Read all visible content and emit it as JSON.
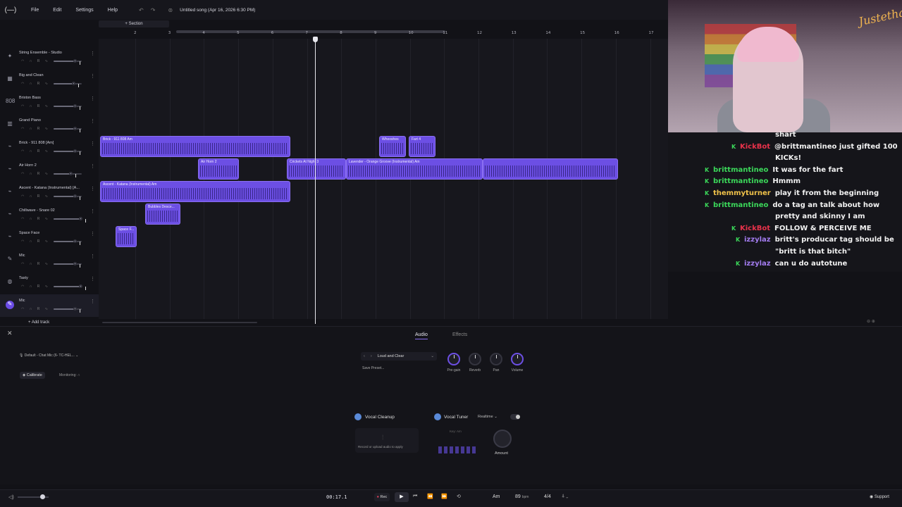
{
  "app": {
    "logo": "(—)",
    "menu": [
      "File",
      "Edit",
      "Settings",
      "Help"
    ],
    "song_title": "Untitled song (Apr 16, 2026 6:30 PM)"
  },
  "section": {
    "label": "+ Section"
  },
  "ruler": {
    "ticks": [
      "2",
      "3",
      "4",
      "5",
      "6",
      "7",
      "8",
      "9",
      "10",
      "11",
      "12",
      "13",
      "14",
      "15",
      "16",
      "17"
    ]
  },
  "tracks": [
    {
      "name": "String Ensemble - Studio",
      "icon": "strings-icon",
      "glyph": "✦",
      "volume": 0.75
    },
    {
      "name": "Big and Clean",
      "icon": "synth-icon",
      "glyph": "▦",
      "volume": 0.72
    },
    {
      "name": "Brixton Bass",
      "icon": "drum-machine-icon",
      "glyph": "808",
      "volume": 0.75
    },
    {
      "name": "Grand Piano",
      "icon": "piano-icon",
      "glyph": "▥",
      "volume": 0.75
    },
    {
      "name": "Brick - 911 808 [Am]",
      "icon": "sample-icon",
      "glyph": "⌁",
      "volume": 0.75
    },
    {
      "name": "Air Horn 2",
      "icon": "sample-icon",
      "glyph": "⌁",
      "volume": 0.6
    },
    {
      "name": "Ascent - Katana (Instrumental) [A...",
      "icon": "sample-icon",
      "glyph": "⌁",
      "volume": 0.75
    },
    {
      "name": "Chillwave - Snare 02",
      "icon": "sample-icon",
      "glyph": "⌁",
      "volume": 0.95
    },
    {
      "name": "Space Face",
      "icon": "sample-icon",
      "glyph": "⌁",
      "volume": 0.75
    },
    {
      "name": "Mic",
      "icon": "mic-icon",
      "glyph": "✎",
      "volume": 0.75
    },
    {
      "name": "Tasty",
      "icon": "drum-icon",
      "glyph": "◍",
      "volume": 0.95
    },
    {
      "name": "Mic",
      "icon": "mic-icon",
      "glyph": "✎",
      "volume": 0.75,
      "selected": true
    }
  ],
  "track_controls": "◠ ∩ R ∿",
  "add_track": "+ Add track",
  "clips": [
    {
      "label": "Brick - 911 808 Am"
    },
    {
      "label": "Whooshes"
    },
    {
      "label": "Fart 4"
    },
    {
      "label": "Air Horn 2"
    },
    {
      "label": "Crickets At Night 3"
    },
    {
      "label": "Lavender - Orange Groove (Instrumental) Am"
    },
    {
      "label": ""
    },
    {
      "label": "Ascent - Katana (Instrumental) Am"
    },
    {
      "label": "Bubbles Desce..."
    },
    {
      "label": "Space F..."
    }
  ],
  "panel": {
    "tabs": [
      "Audio",
      "Effects"
    ],
    "mic_source": "Default - Chat Mic (6- TC-HEL... ⌄",
    "calibrate": "Calibrate",
    "monitoring": "Monitoring:",
    "preset_name": "Loud and Clear",
    "save_preset": "Save Preset...",
    "knobs": [
      "Pre-gain",
      "Reverb",
      "Pan",
      "Volume"
    ],
    "vocal_cleanup": "Vocal Cleanup",
    "vocal_cleanup_hint": "Record or upload audio to apply",
    "vocal_tuner": "Vocal Tuner",
    "tuner_mode": "Realtime",
    "tuner_key": "Key: Am",
    "amount": "Amount"
  },
  "transport": {
    "time": "00:17.1",
    "rec": "Rec",
    "key": "Am",
    "bpm": "89",
    "bpm_unit": "bpm",
    "time_signature": "4/4",
    "support": "Support",
    "master_volume": 0.8
  },
  "webcam": {
    "overlay_tag": "Justethal"
  },
  "chat": [
    {
      "user": "",
      "message": "shart",
      "user_color": "#f2f2f2",
      "badge": false
    },
    {
      "user": "KickBot",
      "message": "@brittmantineo just gifted 100",
      "user_color": "#e8324a",
      "badge": true
    },
    {
      "user": "",
      "message": "KICKs!",
      "user_color": "#f2f2f2",
      "badge": false
    },
    {
      "user": "brittmantineo",
      "message": "It was for the fart",
      "user_color": "#3bd85a",
      "badge": true
    },
    {
      "user": "brittmantineo",
      "message": "Hmmm",
      "user_color": "#3bd85a",
      "badge": true
    },
    {
      "user": "themmyturner",
      "message": "play it from the beginning",
      "user_color": "#f0c24a",
      "badge": true
    },
    {
      "user": "brittmantineo",
      "message": "do a tag an talk about how",
      "user_color": "#3bd85a",
      "badge": true
    },
    {
      "user": "",
      "message": "pretty and skinny I am",
      "user_color": "#f2f2f2",
      "badge": false
    },
    {
      "user": "KickBot",
      "message": "FOLLOW & PERCEIVE ME",
      "user_color": "#e8324a",
      "badge": true
    },
    {
      "user": "izzylaz",
      "message": "britt's producar tag should be",
      "user_color": "#a37cf0",
      "badge": true
    },
    {
      "user": "",
      "message": "\"britt is that bitch\"",
      "user_color": "#f2f2f2",
      "badge": false
    },
    {
      "user": "izzylaz",
      "message": "can u do autotune",
      "user_color": "#a37cf0",
      "badge": true
    }
  ],
  "colors": {
    "accent": "#6c4fe4",
    "kick_green": "#3bd85a"
  }
}
